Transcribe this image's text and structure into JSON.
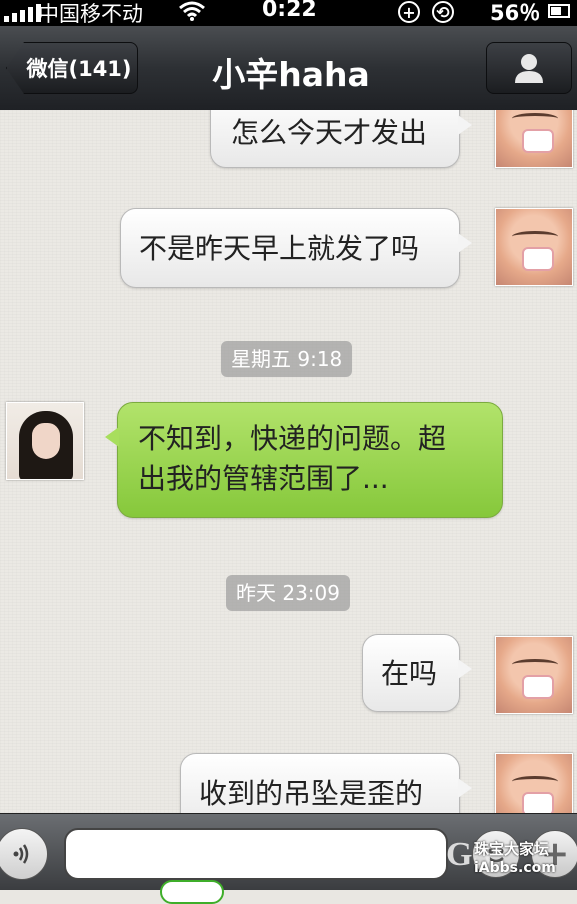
{
  "status_bar": {
    "carrier": "中国移不动",
    "time": "0:22",
    "battery": "56％"
  },
  "nav": {
    "back_label": "微信(141)",
    "title": "小辛haha",
    "profile_icon": "person-icon"
  },
  "messages": [
    {
      "side": "out",
      "text": "怎么今天才发出"
    },
    {
      "side": "out",
      "text": "不是昨天早上就发了吗"
    },
    {
      "type": "timestamp",
      "text": "星期五 9:18"
    },
    {
      "side": "in",
      "line1": "不知到，快递的问题。超",
      "line2": "出我的管辖范围了..."
    },
    {
      "type": "timestamp",
      "text": "昨天 23:09"
    },
    {
      "side": "out",
      "text": "在吗"
    },
    {
      "side": "out",
      "text": "收到的吊坠是歪的"
    }
  ],
  "input_bar": {
    "placeholder": "",
    "voice_icon": "voice-icon",
    "emoji_icon": "emoji-icon",
    "plus_icon": "plus-icon"
  },
  "watermark": {
    "logo": "GS",
    "site": "珠宝大家坛",
    "url": "iAbbs.com"
  },
  "colors": {
    "incoming_bubble": "#9bd451",
    "outgoing_bubble": "#f4f4f4",
    "navbar": "#2d3034"
  }
}
